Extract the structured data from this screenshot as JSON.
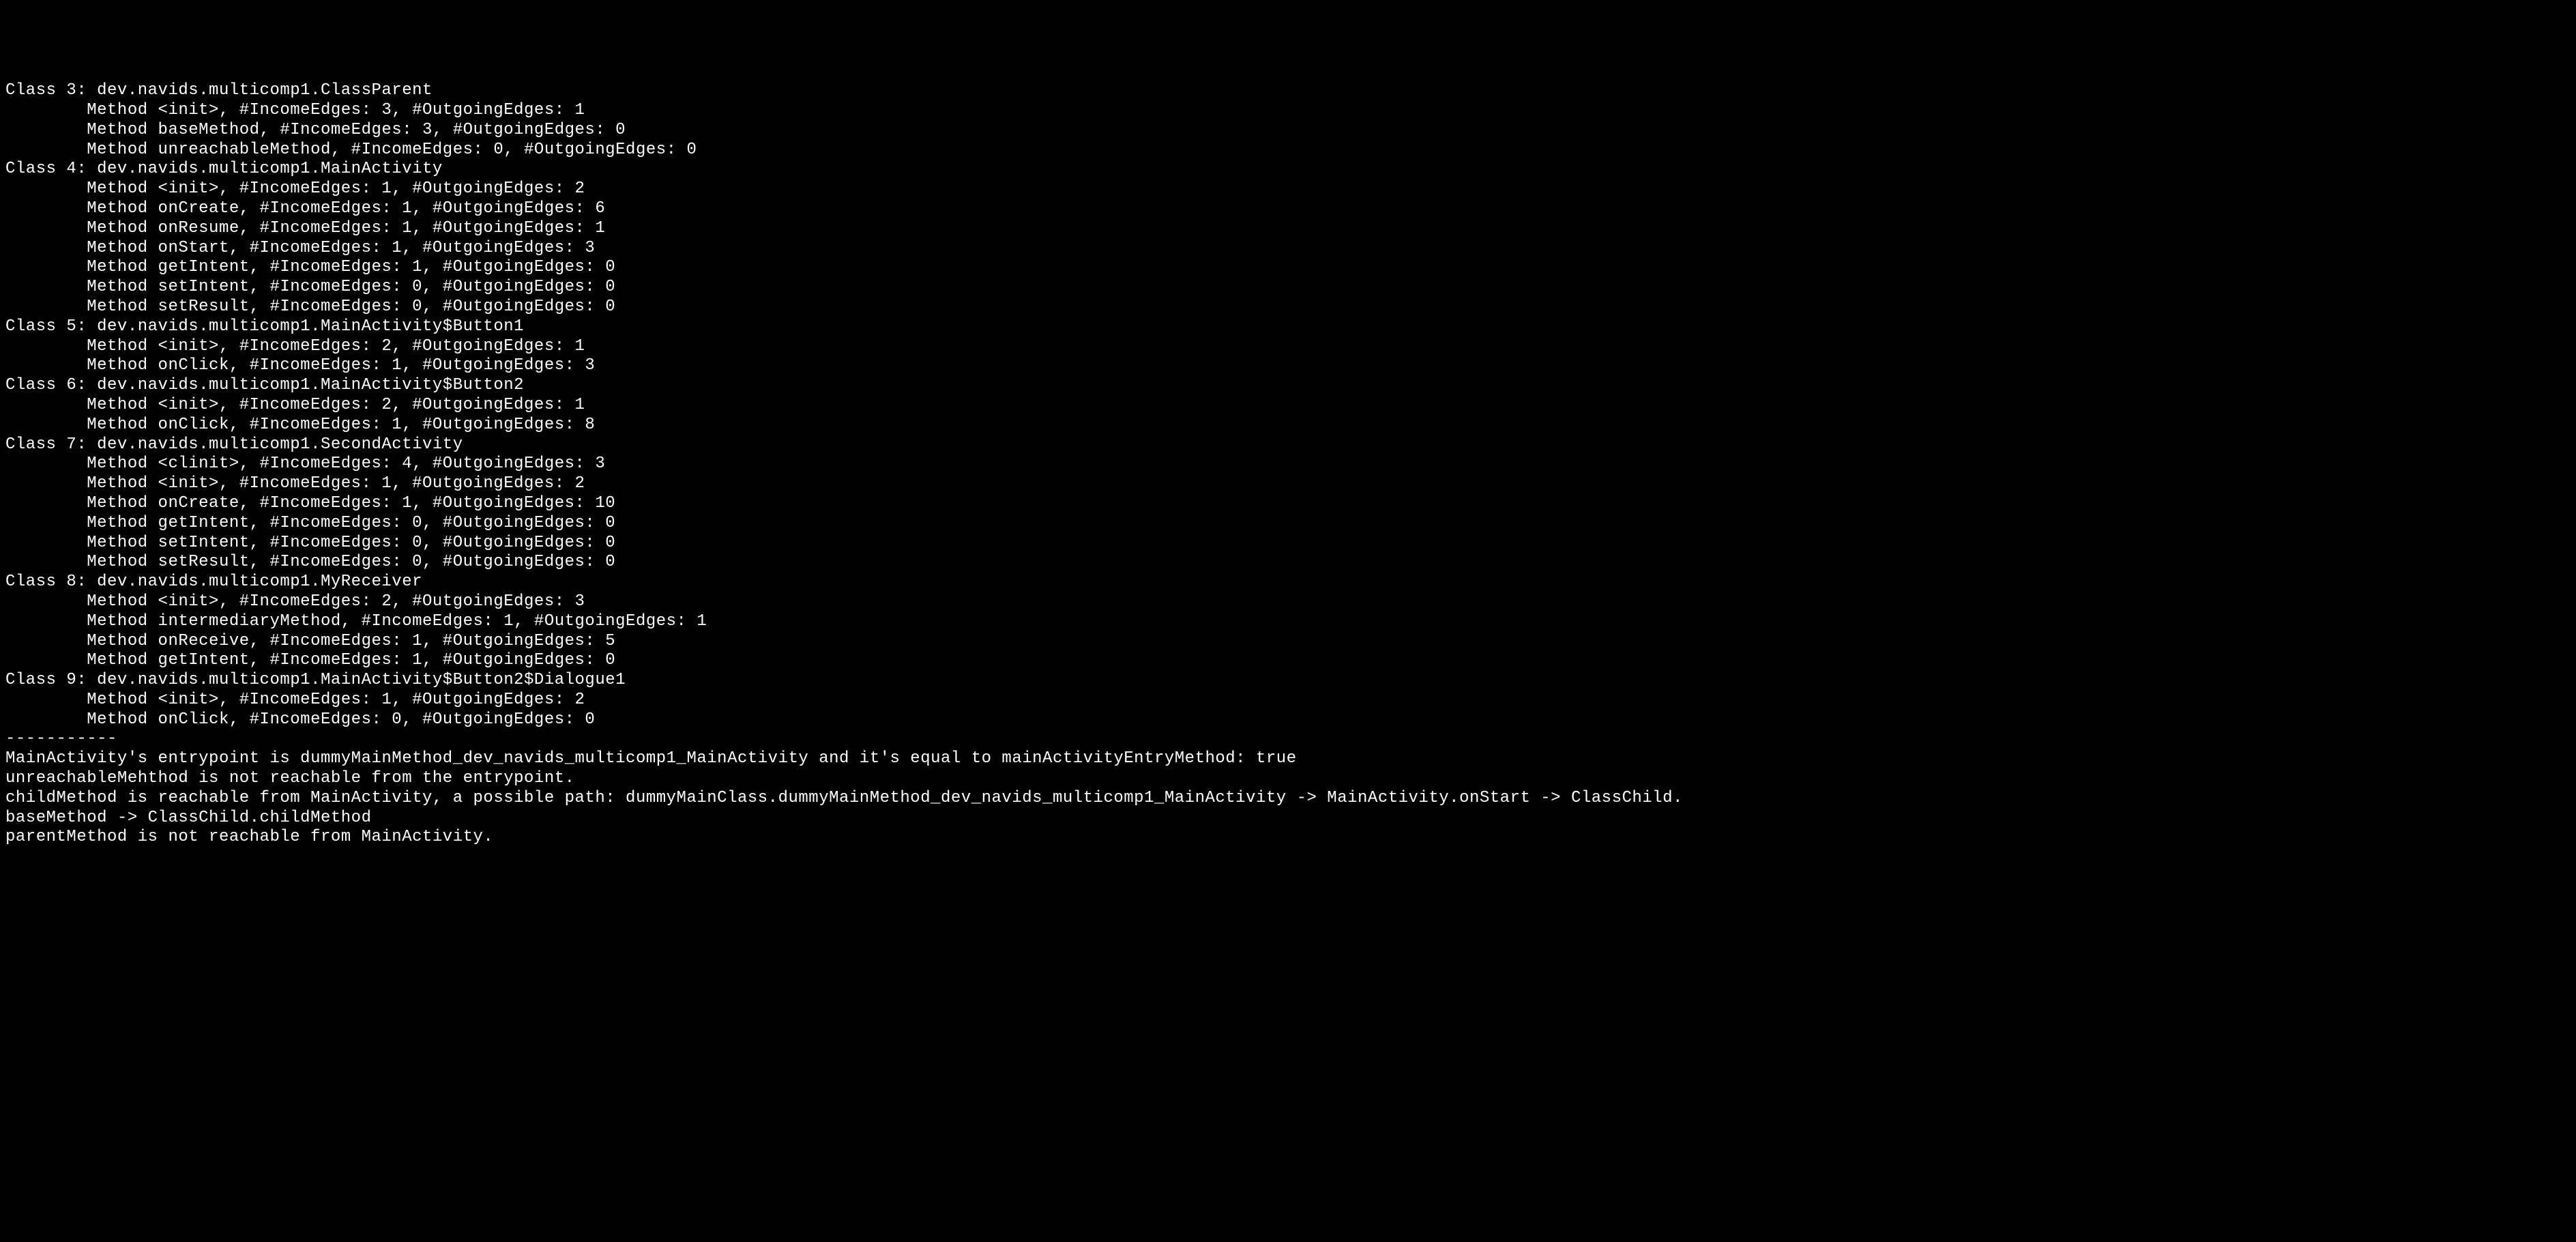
{
  "classes": [
    {
      "index": 3,
      "name": "dev.navids.multicomp1.ClassParent",
      "methods": [
        {
          "name": "<init>",
          "incomeEdges": 3,
          "outgoingEdges": 1
        },
        {
          "name": "baseMethod",
          "incomeEdges": 3,
          "outgoingEdges": 0
        },
        {
          "name": "unreachableMethod",
          "incomeEdges": 0,
          "outgoingEdges": 0
        }
      ]
    },
    {
      "index": 4,
      "name": "dev.navids.multicomp1.MainActivity",
      "methods": [
        {
          "name": "<init>",
          "incomeEdges": 1,
          "outgoingEdges": 2
        },
        {
          "name": "onCreate",
          "incomeEdges": 1,
          "outgoingEdges": 6
        },
        {
          "name": "onResume",
          "incomeEdges": 1,
          "outgoingEdges": 1
        },
        {
          "name": "onStart",
          "incomeEdges": 1,
          "outgoingEdges": 3
        },
        {
          "name": "getIntent",
          "incomeEdges": 1,
          "outgoingEdges": 0
        },
        {
          "name": "setIntent",
          "incomeEdges": 0,
          "outgoingEdges": 0
        },
        {
          "name": "setResult",
          "incomeEdges": 0,
          "outgoingEdges": 0
        }
      ]
    },
    {
      "index": 5,
      "name": "dev.navids.multicomp1.MainActivity$Button1",
      "methods": [
        {
          "name": "<init>",
          "incomeEdges": 2,
          "outgoingEdges": 1
        },
        {
          "name": "onClick",
          "incomeEdges": 1,
          "outgoingEdges": 3
        }
      ]
    },
    {
      "index": 6,
      "name": "dev.navids.multicomp1.MainActivity$Button2",
      "methods": [
        {
          "name": "<init>",
          "incomeEdges": 2,
          "outgoingEdges": 1
        },
        {
          "name": "onClick",
          "incomeEdges": 1,
          "outgoingEdges": 8
        }
      ]
    },
    {
      "index": 7,
      "name": "dev.navids.multicomp1.SecondActivity",
      "methods": [
        {
          "name": "<clinit>",
          "incomeEdges": 4,
          "outgoingEdges": 3
        },
        {
          "name": "<init>",
          "incomeEdges": 1,
          "outgoingEdges": 2
        },
        {
          "name": "onCreate",
          "incomeEdges": 1,
          "outgoingEdges": 10
        },
        {
          "name": "getIntent",
          "incomeEdges": 0,
          "outgoingEdges": 0
        },
        {
          "name": "setIntent",
          "incomeEdges": 0,
          "outgoingEdges": 0
        },
        {
          "name": "setResult",
          "incomeEdges": 0,
          "outgoingEdges": 0
        }
      ]
    },
    {
      "index": 8,
      "name": "dev.navids.multicomp1.MyReceiver",
      "methods": [
        {
          "name": "<init>",
          "incomeEdges": 2,
          "outgoingEdges": 3
        },
        {
          "name": "intermediaryMethod",
          "incomeEdges": 1,
          "outgoingEdges": 1
        },
        {
          "name": "onReceive",
          "incomeEdges": 1,
          "outgoingEdges": 5
        },
        {
          "name": "getIntent",
          "incomeEdges": 1,
          "outgoingEdges": 0
        }
      ]
    },
    {
      "index": 9,
      "name": "dev.navids.multicomp1.MainActivity$Button2$Dialogue1",
      "methods": [
        {
          "name": "<init>",
          "incomeEdges": 1,
          "outgoingEdges": 2
        },
        {
          "name": "onClick",
          "incomeEdges": 0,
          "outgoingEdges": 0
        }
      ]
    }
  ],
  "separator": "-----------",
  "messages": [
    "MainActivity's entrypoint is dummyMainMethod_dev_navids_multicomp1_MainActivity and it's equal to mainActivityEntryMethod: true",
    "unreachableMehthod is not reachable from the entrypoint.",
    "childMethod is reachable from MainActivity, a possible path: dummyMainClass.dummyMainMethod_dev_navids_multicomp1_MainActivity -> MainActivity.onStart -> ClassChild.baseMethod -> ClassChild.childMethod",
    "parentMethod is not reachable from MainActivity."
  ]
}
